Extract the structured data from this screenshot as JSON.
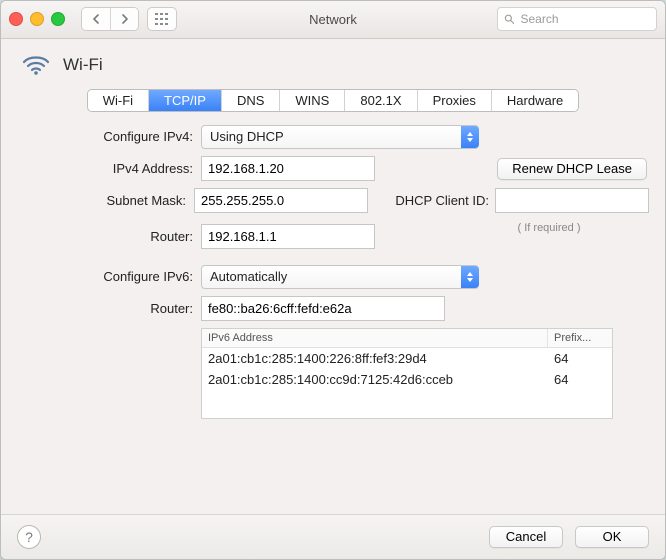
{
  "window": {
    "title": "Network"
  },
  "search": {
    "placeholder": "Search"
  },
  "header": {
    "interface": "Wi-Fi"
  },
  "tabs": [
    "Wi-Fi",
    "TCP/IP",
    "DNS",
    "WINS",
    "802.1X",
    "Proxies",
    "Hardware"
  ],
  "tabs_active_index": 1,
  "ipv4": {
    "configure_label": "Configure IPv4:",
    "configure_value": "Using DHCP",
    "address_label": "IPv4 Address:",
    "address_value": "192.168.1.20",
    "subnet_label": "Subnet Mask:",
    "subnet_value": "255.255.255.0",
    "router_label": "Router:",
    "router_value": "192.168.1.1",
    "renew_button": "Renew DHCP Lease",
    "dhcp_client_id_label": "DHCP Client ID:",
    "dhcp_client_id_value": "",
    "dhcp_client_id_hint": "( If required )"
  },
  "ipv6": {
    "configure_label": "Configure IPv6:",
    "configure_value": "Automatically",
    "router_label": "Router:",
    "router_value": "fe80::ba26:6cff:fefd:e62a",
    "table": {
      "col1": "IPv6 Address",
      "col2": "Prefix...",
      "rows": [
        {
          "addr": "2a01:cb1c:285:1400:226:8ff:fef3:29d4",
          "prefix": "64"
        },
        {
          "addr": "2a01:cb1c:285:1400:cc9d:7125:42d6:cceb",
          "prefix": "64"
        }
      ]
    }
  },
  "footer": {
    "cancel": "Cancel",
    "ok": "OK"
  }
}
